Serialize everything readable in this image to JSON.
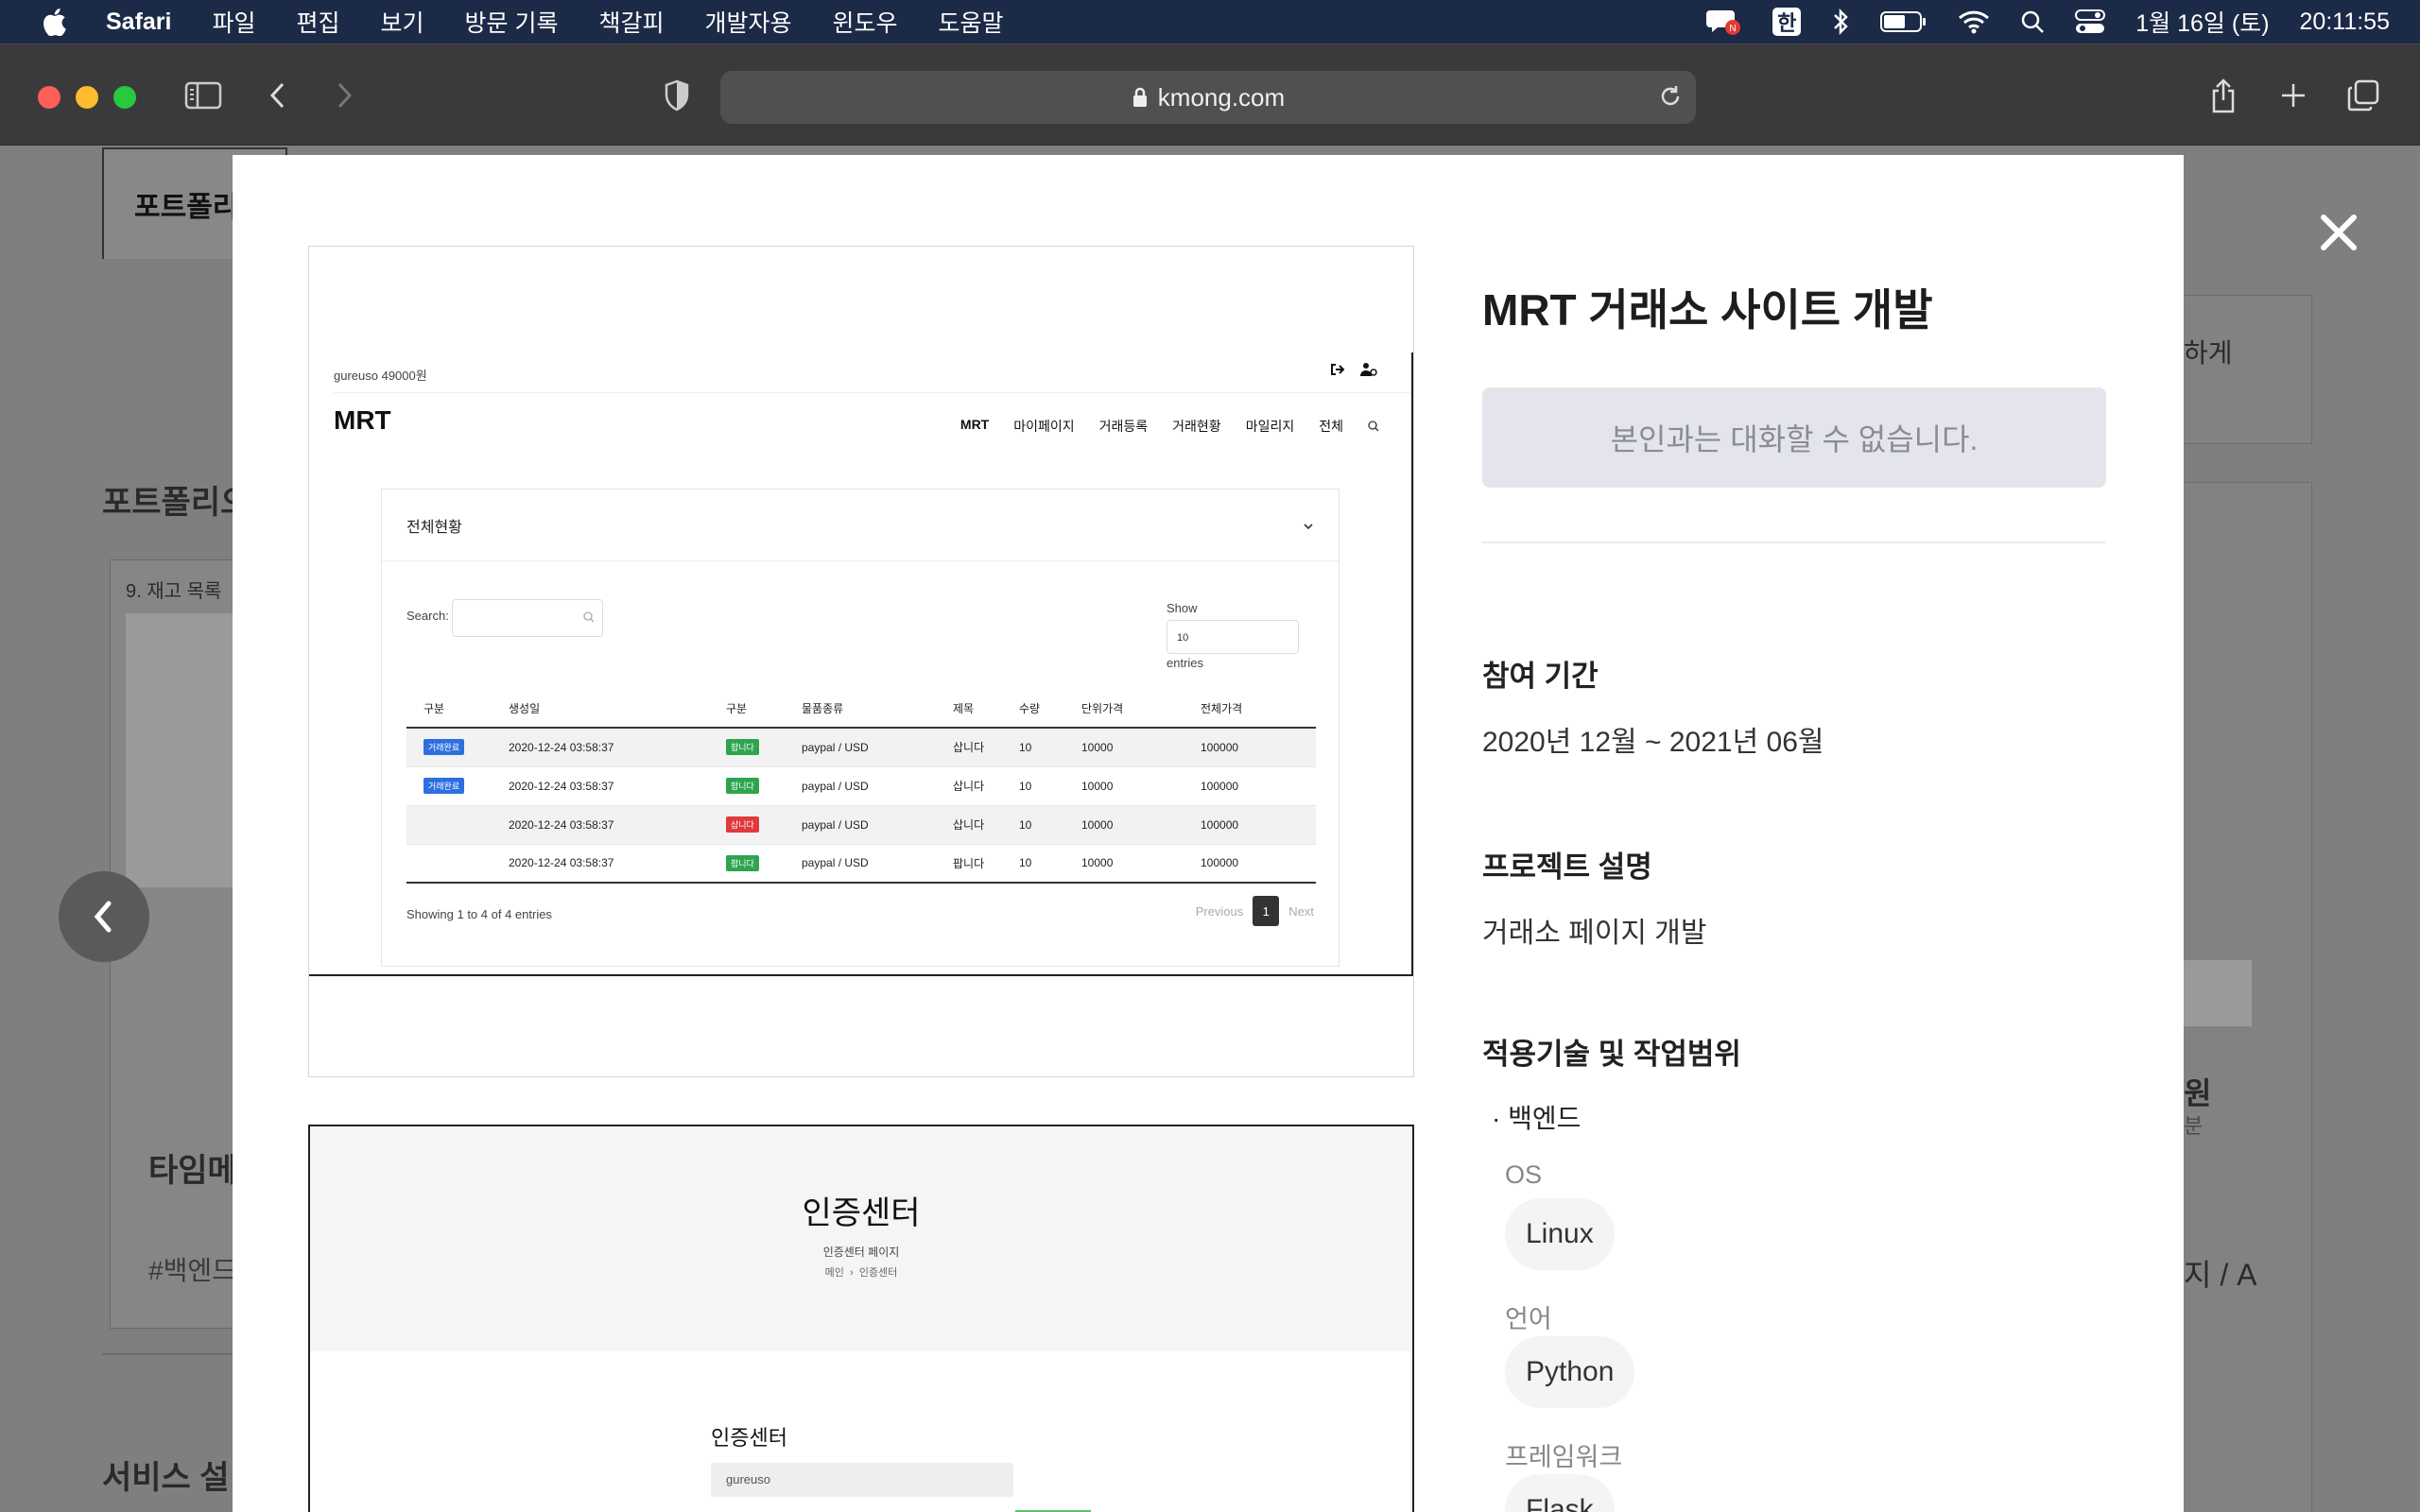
{
  "menubar": {
    "app_name": "Safari",
    "menus": [
      "파일",
      "편집",
      "보기",
      "방문 기록",
      "책갈피",
      "개발자용",
      "윈도우",
      "도움말"
    ],
    "input_method": "한",
    "date": "1월 16일 (토)",
    "time": "20:11:55"
  },
  "browser": {
    "url": "kmong.com"
  },
  "background": {
    "tab_label": "포트폴리오",
    "section_title": "포트폴리오",
    "card_caption": "9. 재고 목록",
    "card_title": "타임메",
    "card_tag": "#백엔드",
    "bottom_title": "서비스 설",
    "right_text_1": "하게",
    "right_text_2": "원",
    "right_text_3": "분",
    "right_text_4": "지 / A"
  },
  "modal": {
    "screenshot1": {
      "user_info": "gureuso 49000원",
      "logo": "MRT",
      "nav": [
        "MRT",
        "마이페이지",
        "거래등록",
        "거래현황",
        "마일리지",
        "전체"
      ],
      "panel_title": "전체현황",
      "search_label": "Search:",
      "show_label": "Show",
      "show_value": "10",
      "entries_label": "entries",
      "columns": [
        "구분",
        "생성일",
        "구분",
        "물품종류",
        "제목",
        "수량",
        "단위가격",
        "전체가격"
      ],
      "rows": [
        {
          "status": "거래완료",
          "date": "2020-12-24 03:58:37",
          "type": "팝니다",
          "type_color": "green",
          "item": "paypal / USD",
          "title": "삽니다",
          "qty": "10",
          "unit": "10000",
          "total": "100000"
        },
        {
          "status": "거래완료",
          "date": "2020-12-24 03:58:37",
          "type": "팝니다",
          "type_color": "green",
          "item": "paypal / USD",
          "title": "삽니다",
          "qty": "10",
          "unit": "10000",
          "total": "100000"
        },
        {
          "status": "",
          "date": "2020-12-24 03:58:37",
          "type": "삽니다",
          "type_color": "red",
          "item": "paypal / USD",
          "title": "삽니다",
          "qty": "10",
          "unit": "10000",
          "total": "100000"
        },
        {
          "status": "",
          "date": "2020-12-24 03:58:37",
          "type": "팝니다",
          "type_color": "green",
          "item": "paypal / USD",
          "title": "팝니다",
          "qty": "10",
          "unit": "10000",
          "total": "100000"
        }
      ],
      "showing": "Showing 1 to 4 of 4 entries",
      "pager_prev": "Previous",
      "pager_current": "1",
      "pager_next": "Next"
    },
    "screenshot2": {
      "title": "인증센터",
      "subtitle": "인증센터 페이지",
      "breadcrumb_home": "메인",
      "breadcrumb_current": "인증센터",
      "form_label": "인증센터",
      "input_value": "gureuso"
    },
    "info": {
      "title": "MRT 거래소 사이트 개발",
      "notice": "본인과는 대화할 수 없습니다.",
      "period_label": "참여 기간",
      "period_value": "2020년 12월 ~ 2021년 06월",
      "desc_label": "프로젝트 설명",
      "desc_value": "거래소 페이지 개발",
      "tech_label": "적용기술 및 작업범위",
      "scope": "· 백엔드",
      "groups": [
        {
          "label": "OS",
          "chip": "Linux"
        },
        {
          "label": "언어",
          "chip": "Python"
        },
        {
          "label": "프레임워크",
          "chip": "Flask"
        }
      ]
    }
  }
}
